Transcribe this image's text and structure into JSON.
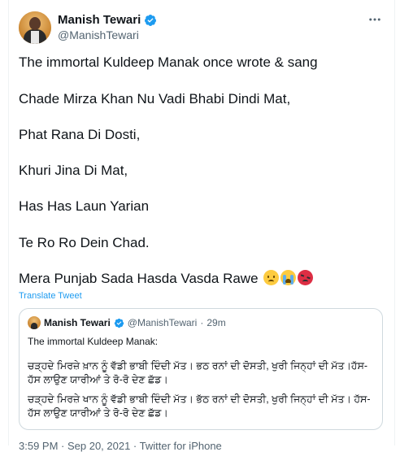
{
  "author": {
    "display_name": "Manish Tewari",
    "handle": "@ManishTewari"
  },
  "more_icon": "more-horizontal-icon",
  "tweet": {
    "lines": [
      "The immortal Kuldeep Manak once wrote & sang",
      "Chade Mirza Khan Nu Vadi Bhabi Dindi Mat,",
      "Phat Rana Di Dosti,",
      "Khuri Jina Di Mat,",
      "Has Has Laun Yarian",
      "Te Ro Ro Dein Chad.",
      "Mera Punjab Sada Hasda Vasda Rawe"
    ],
    "emojis": [
      "sad-face-emoji",
      "crying-face-emoji",
      "angry-face-emoji"
    ]
  },
  "translate_label": "Translate Tweet",
  "quoted": {
    "display_name": "Manish Tewari",
    "handle": "@ManishTewari",
    "dot": "·",
    "time": "29m",
    "text_line": "The immortal Kuldeep Manak:",
    "gurmukhi_1": "ਚੜ੍ਹਦੇ ਮਿਰਜ਼ੇ ਖ਼ਾਨ ਨੂੰ ਵੱਡੀ ਭਾਬੀ ਦਿੰਦੀ ਮੱਤ। ਭਠ ਰਨਾਂ ਦੀ ਦੋਸਤੀ, ਖੁਰੀ ਜਿਨ੍ਹਾਂ ਦੀ ਮੱਤ।ਹੱਸ-ਹੱਸ ਲਾਉਣ ਯਾਰੀਆਂ ਤੇ ਰੋ-ਰੋ ਦੇਣ ਛੱਡ।",
    "gurmukhi_2": "ਚੜ੍ਹਦੇ ਮਿਰਜ਼ੇ ਖਾਨ ਨੂੰ ਵੱਡੀ ਭਾਬੀ ਦਿੰਦੀ ਮੱਤ। ਭੱਠ ਰਨਾਂ ਦੀ ਦੋਸਤੀ, ਖੁਰੀ ਜਿਨ੍ਹਾਂ ਦੀ ਮੱਤ। ਹੱਸ-ਹੱਸ ਲਾਉਣ ਯਾਰੀਆਂ ਤੇ ਰੋ-ਰੋ ਦੇਣ ਛੱਡ।"
  },
  "footer_meta": "3:59 PM · Sep 20, 2021 · Twitter for iPhone",
  "colors": {
    "link": "#1d9bf0",
    "verified": "#1d9bf0",
    "secondary_text": "#536471"
  }
}
